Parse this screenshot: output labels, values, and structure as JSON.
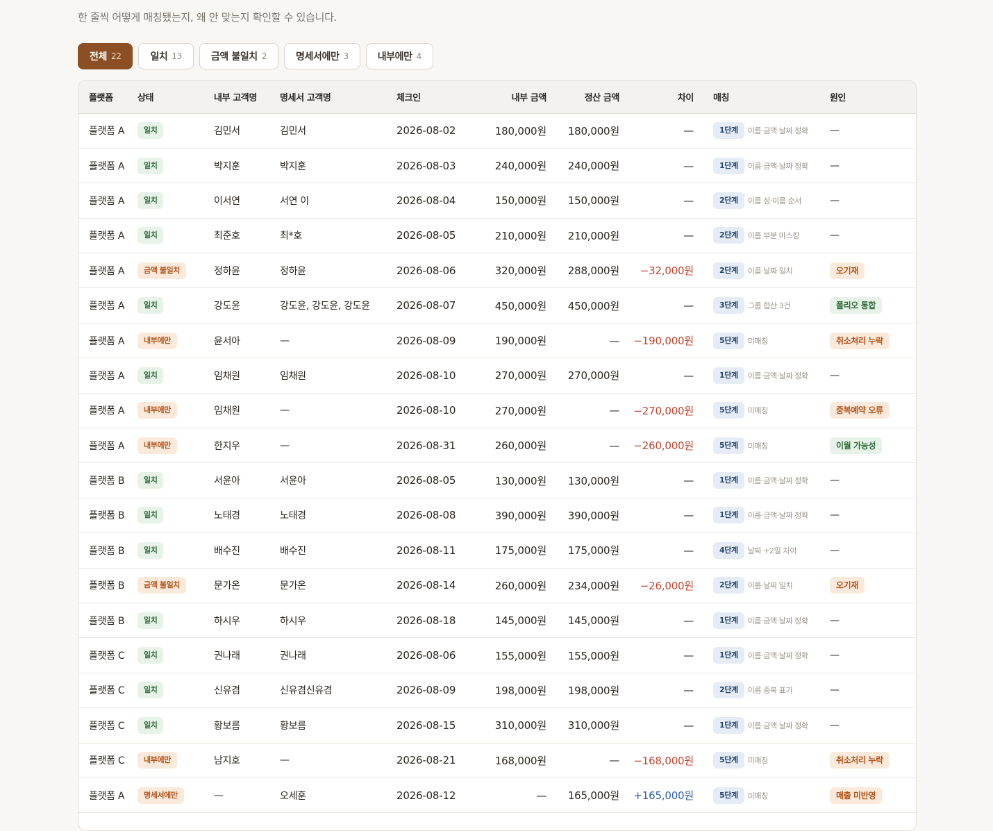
{
  "subtitle": "한 줄씩 어떻게 매칭됐는지, 왜 안 맞는지 확인할 수 있습니다.",
  "tabs": [
    {
      "label": "전체",
      "count": "22",
      "active": true
    },
    {
      "label": "일치",
      "count": "13",
      "active": false
    },
    {
      "label": "금액 불일치",
      "count": "2",
      "active": false
    },
    {
      "label": "명세서에만",
      "count": "3",
      "active": false
    },
    {
      "label": "내부에만",
      "count": "4",
      "active": false
    }
  ],
  "columns": [
    "플랫폼",
    "상태",
    "내부 고객명",
    "명세서 고객명",
    "체크인",
    "내부 금액",
    "정산 금액",
    "차이",
    "매칭",
    "원인"
  ],
  "colors": {
    "accent": "#8c4f23",
    "match_green": "#2f6b3a",
    "warn_orange": "#b5531b",
    "negative": "#c0442e",
    "positive": "#2f5fa6",
    "stage_blue": "#27456e"
  },
  "rows": [
    {
      "platform": "플랫폼 A",
      "status": "일치",
      "status_tone": "green",
      "internal_name": "김민서",
      "statement_name": "김민서",
      "checkin": "2026-08-02",
      "internal_amount": "180,000원",
      "settled_amount": "180,000원",
      "diff": "—",
      "diff_tone": "none",
      "stage": "1단계",
      "match_note": "이름·금액·날짜 정확",
      "cause": "—",
      "cause_tone": "none"
    },
    {
      "platform": "플랫폼 A",
      "status": "일치",
      "status_tone": "green",
      "internal_name": "박지훈",
      "statement_name": "박지훈",
      "checkin": "2026-08-03",
      "internal_amount": "240,000원",
      "settled_amount": "240,000원",
      "diff": "—",
      "diff_tone": "none",
      "stage": "1단계",
      "match_note": "이름·금액·날짜 정확",
      "cause": "—",
      "cause_tone": "none"
    },
    {
      "platform": "플랫폼 A",
      "status": "일치",
      "status_tone": "green",
      "internal_name": "이서연",
      "statement_name": "서연 이",
      "checkin": "2026-08-04",
      "internal_amount": "150,000원",
      "settled_amount": "150,000원",
      "diff": "—",
      "diff_tone": "none",
      "stage": "2단계",
      "match_note": "이름 성·이름 순서",
      "cause": "—",
      "cause_tone": "none"
    },
    {
      "platform": "플랫폼 A",
      "status": "일치",
      "status_tone": "green",
      "internal_name": "최준호",
      "statement_name": "최*호",
      "checkin": "2026-08-05",
      "internal_amount": "210,000원",
      "settled_amount": "210,000원",
      "diff": "—",
      "diff_tone": "none",
      "stage": "2단계",
      "match_note": "이름 부분 마스킹",
      "cause": "—",
      "cause_tone": "none"
    },
    {
      "platform": "플랫폼 A",
      "status": "금액 불일치",
      "status_tone": "orange",
      "internal_name": "정하윤",
      "statement_name": "정하윤",
      "checkin": "2026-08-06",
      "internal_amount": "320,000원",
      "settled_amount": "288,000원",
      "diff": "−32,000원",
      "diff_tone": "neg",
      "stage": "2단계",
      "match_note": "이름·날짜 일치",
      "cause": "오기재",
      "cause_tone": "orange"
    },
    {
      "platform": "플랫폼 A",
      "status": "일치",
      "status_tone": "green",
      "internal_name": "강도윤",
      "statement_name": "강도윤, 강도윤, 강도윤",
      "checkin": "2026-08-07",
      "internal_amount": "450,000원",
      "settled_amount": "450,000원",
      "diff": "—",
      "diff_tone": "none",
      "stage": "3단계",
      "match_note": "그룹 합산 3건",
      "cause": "폴리오 통합",
      "cause_tone": "green"
    },
    {
      "platform": "플랫폼 A",
      "status": "내부에만",
      "status_tone": "orange",
      "internal_name": "윤서아",
      "statement_name": "—",
      "checkin": "2026-08-09",
      "internal_amount": "190,000원",
      "settled_amount": "—",
      "diff": "−190,000원",
      "diff_tone": "neg",
      "stage": "5단계",
      "match_note": "미매칭",
      "cause": "취소처리 누락",
      "cause_tone": "orange"
    },
    {
      "platform": "플랫폼 A",
      "status": "일치",
      "status_tone": "green",
      "internal_name": "임채원",
      "statement_name": "임채원",
      "checkin": "2026-08-10",
      "internal_amount": "270,000원",
      "settled_amount": "270,000원",
      "diff": "—",
      "diff_tone": "none",
      "stage": "1단계",
      "match_note": "이름·금액·날짜 정확",
      "cause": "—",
      "cause_tone": "none"
    },
    {
      "platform": "플랫폼 A",
      "status": "내부에만",
      "status_tone": "orange",
      "internal_name": "임채원",
      "statement_name": "—",
      "checkin": "2026-08-10",
      "internal_amount": "270,000원",
      "settled_amount": "—",
      "diff": "−270,000원",
      "diff_tone": "neg",
      "stage": "5단계",
      "match_note": "미매칭",
      "cause": "중복예약 오류",
      "cause_tone": "orange"
    },
    {
      "platform": "플랫폼 A",
      "status": "내부에만",
      "status_tone": "orange",
      "internal_name": "한지우",
      "statement_name": "—",
      "checkin": "2026-08-31",
      "internal_amount": "260,000원",
      "settled_amount": "—",
      "diff": "−260,000원",
      "diff_tone": "neg",
      "stage": "5단계",
      "match_note": "미매칭",
      "cause": "이월 가능성",
      "cause_tone": "green"
    },
    {
      "platform": "플랫폼 B",
      "status": "일치",
      "status_tone": "green",
      "internal_name": "서윤아",
      "statement_name": "서윤아",
      "checkin": "2026-08-05",
      "internal_amount": "130,000원",
      "settled_amount": "130,000원",
      "diff": "—",
      "diff_tone": "none",
      "stage": "1단계",
      "match_note": "이름·금액·날짜 정확",
      "cause": "—",
      "cause_tone": "none"
    },
    {
      "platform": "플랫폼 B",
      "status": "일치",
      "status_tone": "green",
      "internal_name": "노태경",
      "statement_name": "노태경",
      "checkin": "2026-08-08",
      "internal_amount": "390,000원",
      "settled_amount": "390,000원",
      "diff": "—",
      "diff_tone": "none",
      "stage": "1단계",
      "match_note": "이름·금액·날짜 정확",
      "cause": "—",
      "cause_tone": "none"
    },
    {
      "platform": "플랫폼 B",
      "status": "일치",
      "status_tone": "green",
      "internal_name": "배수진",
      "statement_name": "배수진",
      "checkin": "2026-08-11",
      "internal_amount": "175,000원",
      "settled_amount": "175,000원",
      "diff": "—",
      "diff_tone": "none",
      "stage": "4단계",
      "match_note": "날짜 +2일 차이",
      "cause": "—",
      "cause_tone": "none"
    },
    {
      "platform": "플랫폼 B",
      "status": "금액 불일치",
      "status_tone": "orange",
      "internal_name": "문가온",
      "statement_name": "문가온",
      "checkin": "2026-08-14",
      "internal_amount": "260,000원",
      "settled_amount": "234,000원",
      "diff": "−26,000원",
      "diff_tone": "neg",
      "stage": "2단계",
      "match_note": "이름·날짜 일치",
      "cause": "오기재",
      "cause_tone": "orange"
    },
    {
      "platform": "플랫폼 B",
      "status": "일치",
      "status_tone": "green",
      "internal_name": "하시우",
      "statement_name": "하시우",
      "checkin": "2026-08-18",
      "internal_amount": "145,000원",
      "settled_amount": "145,000원",
      "diff": "—",
      "diff_tone": "none",
      "stage": "1단계",
      "match_note": "이름·금액·날짜 정확",
      "cause": "—",
      "cause_tone": "none"
    },
    {
      "platform": "플랫폼 C",
      "status": "일치",
      "status_tone": "green",
      "internal_name": "권나래",
      "statement_name": "권나래",
      "checkin": "2026-08-06",
      "internal_amount": "155,000원",
      "settled_amount": "155,000원",
      "diff": "—",
      "diff_tone": "none",
      "stage": "1단계",
      "match_note": "이름·금액·날짜 정확",
      "cause": "—",
      "cause_tone": "none"
    },
    {
      "platform": "플랫폼 C",
      "status": "일치",
      "status_tone": "green",
      "internal_name": "신유겸",
      "statement_name": "신유겸신유겸",
      "checkin": "2026-08-09",
      "internal_amount": "198,000원",
      "settled_amount": "198,000원",
      "diff": "—",
      "diff_tone": "none",
      "stage": "2단계",
      "match_note": "이름 중복 표기",
      "cause": "—",
      "cause_tone": "none"
    },
    {
      "platform": "플랫폼 C",
      "status": "일치",
      "status_tone": "green",
      "internal_name": "황보름",
      "statement_name": "황보름",
      "checkin": "2026-08-15",
      "internal_amount": "310,000원",
      "settled_amount": "310,000원",
      "diff": "—",
      "diff_tone": "none",
      "stage": "1단계",
      "match_note": "이름·금액·날짜 정확",
      "cause": "—",
      "cause_tone": "none"
    },
    {
      "platform": "플랫폼 C",
      "status": "내부에만",
      "status_tone": "orange",
      "internal_name": "남지호",
      "statement_name": "—",
      "checkin": "2026-08-21",
      "internal_amount": "168,000원",
      "settled_amount": "—",
      "diff": "−168,000원",
      "diff_tone": "neg",
      "stage": "5단계",
      "match_note": "미매칭",
      "cause": "취소처리 누락",
      "cause_tone": "orange"
    },
    {
      "platform": "플랫폼 A",
      "status": "명세서에만",
      "status_tone": "orange",
      "internal_name": "—",
      "statement_name": "오세훈",
      "checkin": "2026-08-12",
      "internal_amount": "—",
      "settled_amount": "165,000원",
      "diff": "+165,000원",
      "diff_tone": "pos",
      "stage": "5단계",
      "match_note": "미매칭",
      "cause": "매출 미반영",
      "cause_tone": "orange"
    }
  ]
}
